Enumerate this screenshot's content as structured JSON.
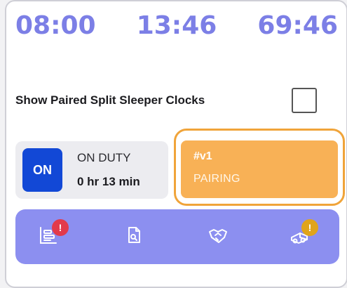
{
  "clocks": {
    "break": "08:00",
    "drive": "13:46",
    "cycle": "69:46"
  },
  "split_sleeper": {
    "label": "Show Paired Split Sleeper Clocks",
    "checked": false
  },
  "duty": {
    "badge": "ON",
    "status": "ON DUTY",
    "duration": "0 hr 13 min"
  },
  "pairing": {
    "id": "#v1",
    "status": "PAIRING"
  },
  "toolbar": {
    "items": [
      {
        "icon": "logs-icon",
        "badge": "!",
        "badge_color": "#e23a4b"
      },
      {
        "icon": "document-search-icon"
      },
      {
        "icon": "handshake-icon"
      },
      {
        "icon": "truck-icon",
        "badge": "!",
        "badge_color": "#e0a41b"
      }
    ]
  },
  "colors": {
    "clock_text": "#7c7fe6",
    "on_badge": "#1248d6",
    "pairing_fill": "#f8b156",
    "pairing_outline": "#f0a43a",
    "toolbar_bg": "#8c8ff0"
  }
}
